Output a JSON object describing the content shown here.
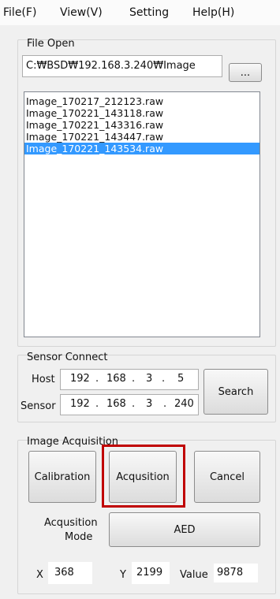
{
  "menu": [
    "File(F)",
    "View(V)",
    "Setting",
    "Help(H)"
  ],
  "file_open": {
    "label": "File Open",
    "path_value": "C:₩BSD₩192.168.3.240₩Image",
    "browse_label": "...",
    "files": [
      "Image_170217_212123.raw",
      "Image_170221_143118.raw",
      "Image_170221_143316.raw",
      "Image_170221_143447.raw",
      "Image_170221_143534.raw"
    ],
    "selected_index": 4
  },
  "sensor_connect": {
    "label": "Sensor Connect",
    "host_label": "Host",
    "host_ip": [
      "192",
      "168",
      "3",
      "5"
    ],
    "sensor_label": "Sensor",
    "sensor_ip": [
      "192",
      "168",
      "3",
      "240"
    ],
    "search_label": "Search"
  },
  "image_acquisition": {
    "label": "Image Acquisition",
    "calibration_label": "Calibration",
    "acquisition_label": "Acqusition",
    "cancel_label": "Cancel",
    "mode_label_line1": "Acqusition",
    "mode_label_line2": "Mode",
    "mode_value": "AED"
  },
  "readout": {
    "x_label": "X",
    "x_value": "368",
    "y_label": "Y",
    "y_value": "2199",
    "value_label": "Value",
    "value_value": "9878"
  },
  "colors": {
    "selection": "#3399ff",
    "highlight": "#c00000"
  }
}
